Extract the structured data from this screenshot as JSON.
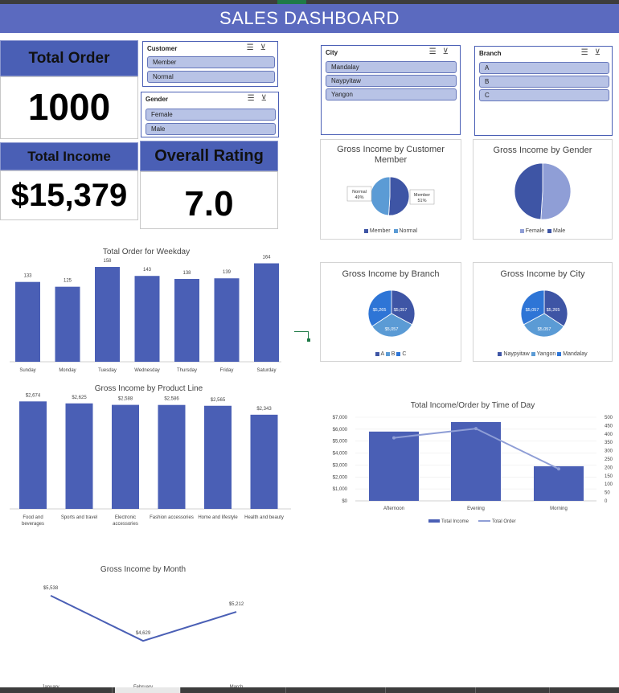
{
  "dashboard": {
    "title": "SALES DASHBOARD"
  },
  "kpis": {
    "total_order_label": "Total Order",
    "total_order_value": "1000",
    "total_income_label": "Total Income",
    "total_income_value": "$15,379",
    "overall_rating_label": "Overall Rating",
    "overall_rating_value": "7.0"
  },
  "slicers": {
    "customer": {
      "title": "Customer",
      "items": [
        "Member",
        "Normal"
      ]
    },
    "gender": {
      "title": "Gender",
      "items": [
        "Female",
        "Male"
      ]
    },
    "city": {
      "title": "City",
      "items": [
        "Mandalay",
        "Naypyitaw",
        "Yangon"
      ]
    },
    "branch": {
      "title": "Branch",
      "items": [
        "A",
        "B",
        "C"
      ]
    }
  },
  "colors": {
    "accent": "#4a5fb5",
    "banner": "#5b6abf",
    "bar": "#4a5fb5",
    "slicer_item": "#b8c3e6",
    "pie_dark": "#3e55a5",
    "pie_light": "#5b9bd5",
    "pie_mid": "#2e75d6",
    "line_light": "#8f9ed6"
  },
  "chart_data": [
    {
      "type": "bar",
      "title": "Total Order for Weekday",
      "categories": [
        "Sunday",
        "Monday",
        "Tuesday",
        "Wednesday",
        "Thursday",
        "Friday",
        "Saturday"
      ],
      "values": [
        133,
        125,
        158,
        143,
        138,
        139,
        164
      ],
      "labels": [
        "133",
        "125",
        "158",
        "143",
        "138",
        "139",
        "164"
      ]
    },
    {
      "type": "bar",
      "title": "Gross Income by Product Line",
      "categories": [
        "Food and beverages",
        "Sports and travel",
        "Electronic accessories",
        "Fashion accessories",
        "Home and lifestyle",
        "Health and beauty"
      ],
      "values": [
        2674,
        2625,
        2588,
        2586,
        2565,
        2343
      ],
      "labels": [
        "$2,674",
        "$2,625",
        "$2,588",
        "$2,586",
        "$2,565",
        "$2,343"
      ]
    },
    {
      "type": "line",
      "title": "Gross Income by Month",
      "categories": [
        "January",
        "February",
        "March"
      ],
      "values": [
        5538,
        4629,
        5212
      ],
      "labels": [
        "$5,538",
        "$4,629",
        "$5,212"
      ]
    },
    {
      "type": "pie",
      "title": "Gross Income by Customer Member",
      "categories": [
        "Member",
        "Normal"
      ],
      "values": [
        51,
        49
      ],
      "labels": [
        "Member 51%",
        "Normal 49%"
      ]
    },
    {
      "type": "pie",
      "title": "Gross Income by Gender",
      "categories": [
        "Female",
        "Male"
      ],
      "values": [
        51,
        49
      ]
    },
    {
      "type": "pie",
      "title": "Gross Income by Branch",
      "categories": [
        "A",
        "B",
        "C"
      ],
      "values": [
        5057,
        5057,
        5265
      ],
      "labels": [
        "$5,057",
        "$5,057",
        "$5,265"
      ]
    },
    {
      "type": "pie",
      "title": "Gross Income by City",
      "categories": [
        "Naypyitaw",
        "Yangon",
        "Mandalay"
      ],
      "values": [
        5265,
        5057,
        5057
      ],
      "labels": [
        "$5,265",
        "$5,057",
        "$5,057"
      ]
    },
    {
      "type": "bar",
      "title": "Total Income/Order by Time of Day",
      "categories": [
        "Afternoon",
        "Evening",
        "Morning"
      ],
      "series": [
        {
          "name": "Total Income",
          "type": "bar",
          "values": [
            5800,
            6600,
            2900
          ]
        },
        {
          "name": "Total Order",
          "type": "line",
          "values": [
            377,
            432,
            191
          ]
        }
      ],
      "y_ticks": [
        "$7,000",
        "$6,000",
        "$5,000",
        "$4,000",
        "$3,000",
        "$2,000",
        "$1,000",
        "$0"
      ],
      "y2_ticks": [
        "500",
        "450",
        "400",
        "350",
        "300",
        "250",
        "200",
        "150",
        "100",
        "50",
        "0"
      ],
      "ylim": [
        0,
        7000
      ],
      "y2lim": [
        0,
        500
      ]
    }
  ]
}
